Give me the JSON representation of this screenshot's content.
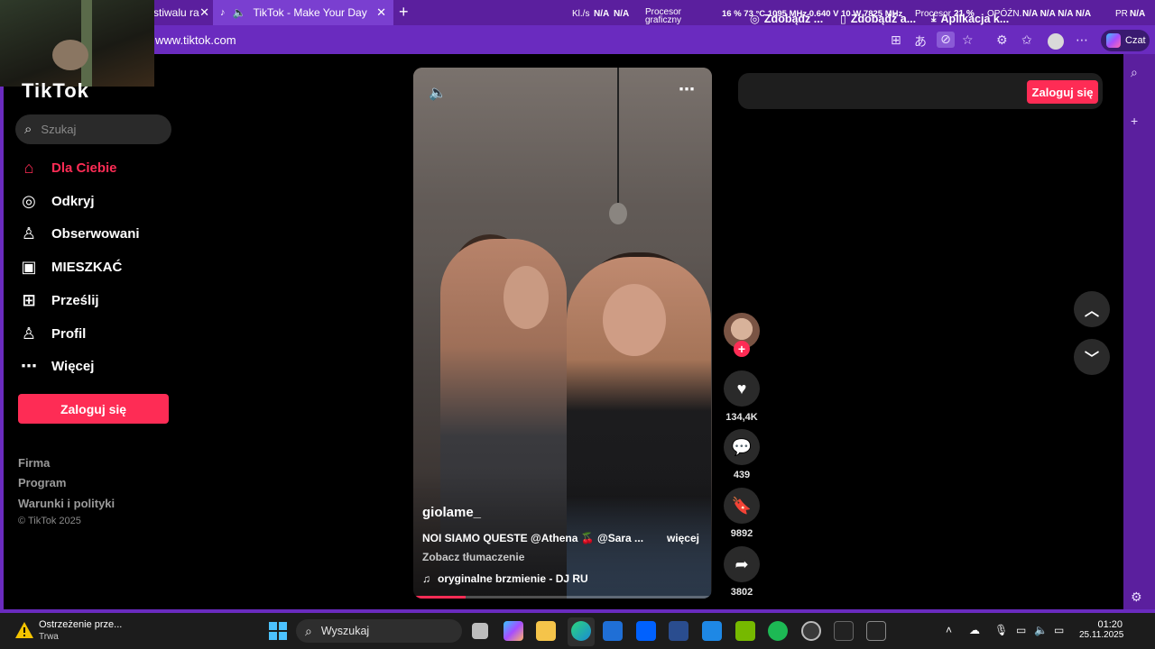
{
  "browser": {
    "tabs": [
      {
        "title": "stiwalu ra",
        "close": "✕"
      },
      {
        "title": "TikTok - Make Your Day",
        "close": "✕"
      }
    ],
    "new_tab": "+",
    "url": "www.tiktok.com",
    "czat_label": "Czat"
  },
  "osd": {
    "kls_label": "Kl./s",
    "kls_val1": "N/A",
    "kls_val2": "N/A",
    "gpu_label1": "Procesor",
    "gpu_label2": "graficzny",
    "gpu_stats": "16 %  73 °C  1095 MHz  0.640 V  10 W  7825 MHz",
    "cpu_label": "Procesor",
    "cpu_val": "21 %",
    "lat_label": "OPÓŹN.",
    "lat_vals": "N/A  N/A  N/A  N/A",
    "pr_label": "PR",
    "pr_val": "N/A"
  },
  "tiktok": {
    "logo": "TikTok",
    "search_placeholder": "Szukaj",
    "nav": [
      {
        "label": "Dla Ciebie",
        "icon": "home-icon"
      },
      {
        "label": "Odkryj",
        "icon": "compass-icon"
      },
      {
        "label": "Obserwowani",
        "icon": "following-icon"
      },
      {
        "label": "MIESZKAĆ",
        "icon": "live-icon"
      },
      {
        "label": "Prześlij",
        "icon": "upload-icon"
      },
      {
        "label": "Profil",
        "icon": "profile-icon"
      },
      {
        "label": "Więcej",
        "icon": "more-icon"
      }
    ],
    "login_label": "Zaloguj się",
    "footer": [
      "Firma",
      "Program",
      "Warunki i polityki"
    ],
    "copyright": "© TikTok 2025",
    "top_bar": {
      "item1": "Zdobądź ...",
      "item2": "Zdobądź a...",
      "item3": "Aplikacja k...",
      "login": "Zaloguj się"
    },
    "video": {
      "author": "giolame_",
      "description": "NOI SIAMO QUESTE @Athena 🍒 @Sara ...",
      "more": "więcej",
      "translate": "Zobacz tłumaczenie",
      "sound": "oryginalne brzmienie - DJ RU",
      "progress": 0.175
    },
    "actions": {
      "likes": "134,4K",
      "comments": "439",
      "saves": "9892",
      "shares": "3802"
    }
  },
  "taskbar": {
    "warning_title": "Ostrzeżenie prze...",
    "warning_sub": "Trwa",
    "search": "Wyszukaj",
    "time": "01:20",
    "date": "25.11.2025"
  }
}
